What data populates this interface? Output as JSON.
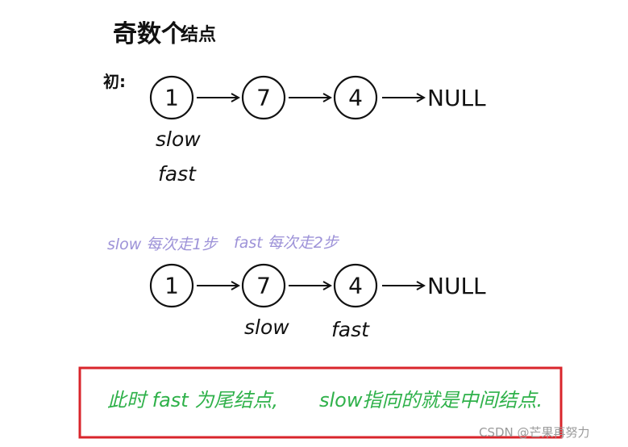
{
  "title": {
    "main": "奇数个",
    "sub": "结点"
  },
  "initial_label": "初:",
  "list_initial": {
    "nodes": [
      "1",
      "7",
      "4"
    ],
    "terminator": "NULL",
    "pointers": [
      {
        "label": "slow",
        "node": 0
      },
      {
        "label": "fast",
        "node": 0
      }
    ]
  },
  "step_note": {
    "slow": "slow 每次走1步",
    "fast": "fast 每次走2步"
  },
  "list_after": {
    "nodes": [
      "1",
      "7",
      "4"
    ],
    "terminator": "NULL",
    "pointers": [
      {
        "label": "slow",
        "node": 1
      },
      {
        "label": "fast",
        "node": 2
      }
    ]
  },
  "conclusion": {
    "part1": "此时 fast 为尾结点,",
    "part2": "slow指向的就是中间结点."
  },
  "watermark": "CSDN @芒果再努力",
  "colors": {
    "ink": "#111111",
    "note": "#9d92d8",
    "conclusion_text": "#2fb14a",
    "conclusion_border": "#d9252b",
    "watermark": "#9a9a9a"
  }
}
